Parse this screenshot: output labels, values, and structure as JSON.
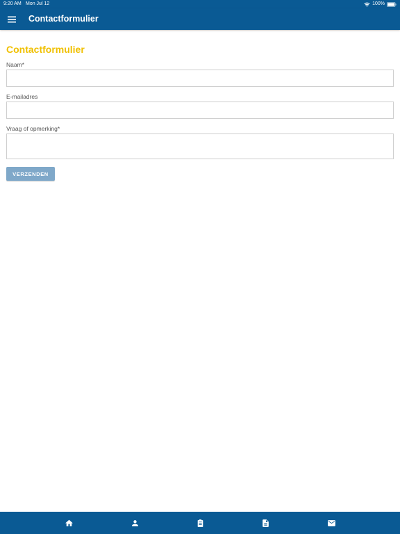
{
  "status_bar": {
    "time": "9:20 AM",
    "date": "Mon Jul 12",
    "battery": "100%"
  },
  "header": {
    "title": "Contactformulier",
    "menu_icon": "hamburger-menu-icon"
  },
  "form": {
    "title": "Contactformulier",
    "fields": [
      {
        "label": "Naam*",
        "value": "",
        "placeholder": ""
      },
      {
        "label": "E-mailadres",
        "value": "",
        "placeholder": ""
      },
      {
        "label": "Vraag of opmerking*",
        "value": "",
        "placeholder": ""
      }
    ],
    "submit_label": "VERZENDEN"
  },
  "bottom_nav": {
    "items": [
      {
        "icon": "home-icon"
      },
      {
        "icon": "person-icon"
      },
      {
        "icon": "clipboard-icon"
      },
      {
        "icon": "document-icon"
      },
      {
        "icon": "mail-icon"
      }
    ]
  },
  "colors": {
    "primary": "#0a5a94",
    "accent": "#f0c000",
    "button": "#7fa8c9"
  }
}
